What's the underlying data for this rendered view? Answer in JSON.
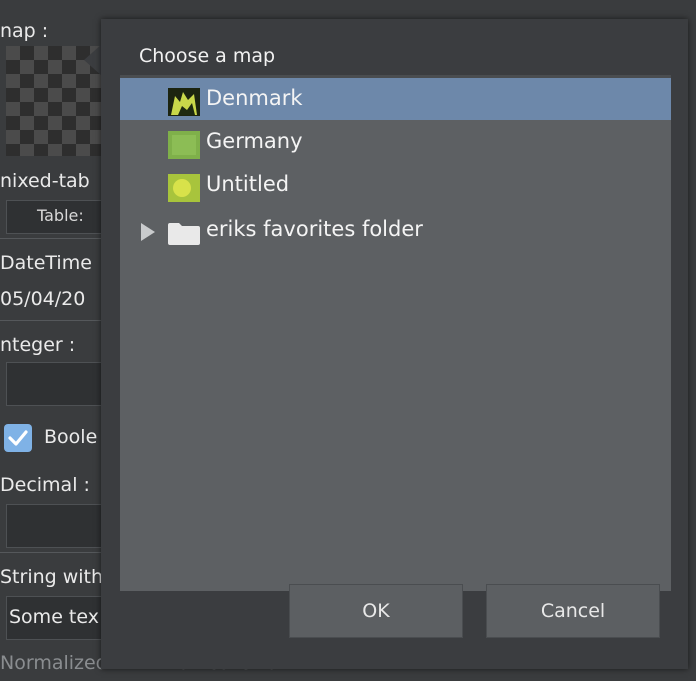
{
  "background": {
    "map_label": "nap :",
    "mixed_table_label": "nixed-tab",
    "table_label": "Table:",
    "datetime_label": "DateTime",
    "datetime_value": "05/04/20",
    "integer_label": "nteger :",
    "boolean_label": "Boole",
    "decimal_label": "Decimal :",
    "string_label": "String with",
    "string_value": "Some tex",
    "normalized_label": "Normalized with max constraint :"
  },
  "dialog": {
    "title": "Choose a map",
    "items": [
      {
        "label": "Denmark",
        "icon": "map-thumbnail-denmark-icon",
        "selected": true
      },
      {
        "label": "Germany",
        "icon": "map-thumbnail-germany-icon",
        "selected": false
      },
      {
        "label": "Untitled",
        "icon": "map-thumbnail-untitled-icon",
        "selected": false
      }
    ],
    "folder": {
      "label": "eriks favorites folder",
      "icon": "folder-icon",
      "expand_icon": "triangle-right-icon"
    },
    "ok_label": "OK",
    "cancel_label": "Cancel"
  },
  "colors": {
    "selection": "#6d88aa",
    "panel": "#5d6063",
    "dialog": "#3b3d40",
    "checkbox": "#7fb2e6"
  }
}
